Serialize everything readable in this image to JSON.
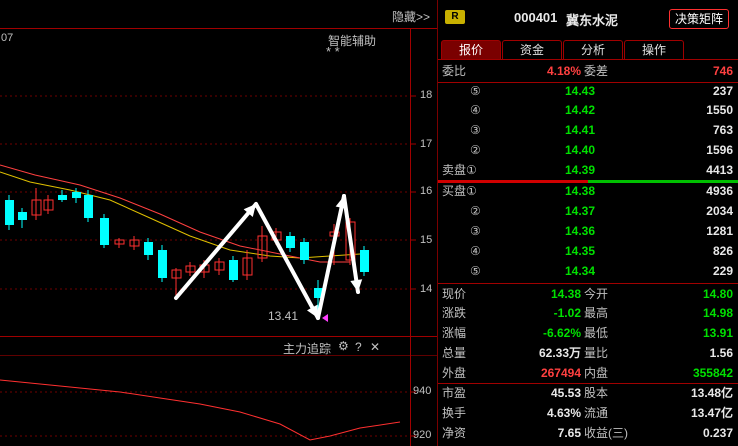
{
  "chart": {
    "corner_label": "07",
    "indicator_title": "智能辅助",
    "indicator_stars": "* *",
    "hide_label": "隐藏>>",
    "low_label": "13.41",
    "y_labels": [
      "18",
      "17",
      "16",
      "15",
      "14"
    ],
    "sub_title": "主力追踪",
    "sub_icons": [
      "⚙",
      "?",
      "✕"
    ],
    "sub_y_labels": [
      "940",
      "920"
    ],
    "colors": {
      "up_candle": "#ff3030",
      "down_candle": "#00ffff",
      "ma": "#e0c000",
      "ma2": "#ff4040",
      "arrow": "#ffffff"
    }
  },
  "header": {
    "badge": "R",
    "code": "000401",
    "name": "冀东水泥",
    "decision_button": "决策矩阵"
  },
  "tabs": [
    "报价",
    "资金",
    "分析",
    "操作"
  ],
  "weibi": {
    "label1": "委比",
    "value1": "4.18%",
    "label2": "委差",
    "value2": "746"
  },
  "sell_orders": [
    {
      "level": "⑤",
      "price": "14.43",
      "volume": "237"
    },
    {
      "level": "④",
      "price": "14.42",
      "volume": "1550"
    },
    {
      "level": "③",
      "price": "14.41",
      "volume": "763"
    },
    {
      "level": "②",
      "price": "14.40",
      "volume": "1596"
    },
    {
      "level": "卖盘①",
      "price": "14.39",
      "volume": "4413"
    }
  ],
  "buy_orders": [
    {
      "level": "买盘①",
      "price": "14.38",
      "volume": "4936"
    },
    {
      "level": "②",
      "price": "14.37",
      "volume": "2034"
    },
    {
      "level": "③",
      "price": "14.36",
      "volume": "1281"
    },
    {
      "level": "④",
      "price": "14.35",
      "volume": "826"
    },
    {
      "level": "⑤",
      "price": "14.34",
      "volume": "229"
    }
  ],
  "quote": [
    {
      "l1": "现价",
      "v1": "14.38",
      "c1": "green",
      "l2": "今开",
      "v2": "14.80",
      "c2": "green"
    },
    {
      "l1": "涨跌",
      "v1": "-1.02",
      "c1": "green",
      "l2": "最高",
      "v2": "14.98",
      "c2": "green"
    },
    {
      "l1": "涨幅",
      "v1": "-6.62%",
      "c1": "green",
      "l2": "最低",
      "v2": "13.91",
      "c2": "green"
    },
    {
      "l1": "总量",
      "v1": "62.33万",
      "c1": "white",
      "l2": "量比",
      "v2": "1.56",
      "c2": "white"
    },
    {
      "l1": "外盘",
      "v1": "267494",
      "c1": "red",
      "l2": "内盘",
      "v2": "355842",
      "c2": "green"
    },
    {
      "l1": "市盈",
      "v1": "45.53",
      "c1": "white",
      "l2": "股本",
      "v2": "13.48亿",
      "c2": "white"
    },
    {
      "l1": "换手",
      "v1": "4.63%",
      "c1": "white",
      "l2": "流通",
      "v2": "13.47亿",
      "c2": "white"
    },
    {
      "l1": "净资",
      "v1": "7.65",
      "c1": "white",
      "l2": "收益(三)",
      "v2": "0.237",
      "c2": "white"
    }
  ]
}
